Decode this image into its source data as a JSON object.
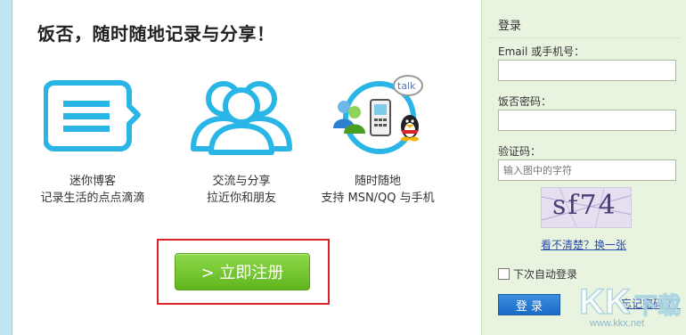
{
  "main": {
    "slogan": "饭否，随时随地记录与分享！",
    "features": [
      {
        "icon": "speech-bubble-icon",
        "line1": "迷你博客",
        "line2": "记录生活的点点滴滴"
      },
      {
        "icon": "people-icon",
        "line1": "交流与分享",
        "line2": "拉近你和朋友"
      },
      {
        "icon": "im-apps-icon",
        "line1": "随时随地",
        "line2": "支持 MSN/QQ 与手机"
      }
    ],
    "register_label": "> 立即注册"
  },
  "login": {
    "title": "登录",
    "email_label": "Email 或手机号：",
    "email_value": "",
    "password_label": "饭否密码：",
    "password_value": "",
    "captcha_label": "验证码：",
    "captcha_placeholder": "输入图中的字符",
    "captcha_image_text": "sf74",
    "captcha_refresh_label": "看不清楚？换一张",
    "remember_label": "下次自动登录",
    "remember_checked": false,
    "login_button_label": "登 录",
    "forgot_label": "忘记密码了?"
  },
  "watermark": {
    "text": "www.kkx.net"
  },
  "colors": {
    "accent_cyan": "#29b6e6",
    "register_green": "#6cc02b",
    "login_blue": "#1b6cc7",
    "sidebar_bg": "#e9f4e0",
    "highlight_red": "#d9232a"
  }
}
